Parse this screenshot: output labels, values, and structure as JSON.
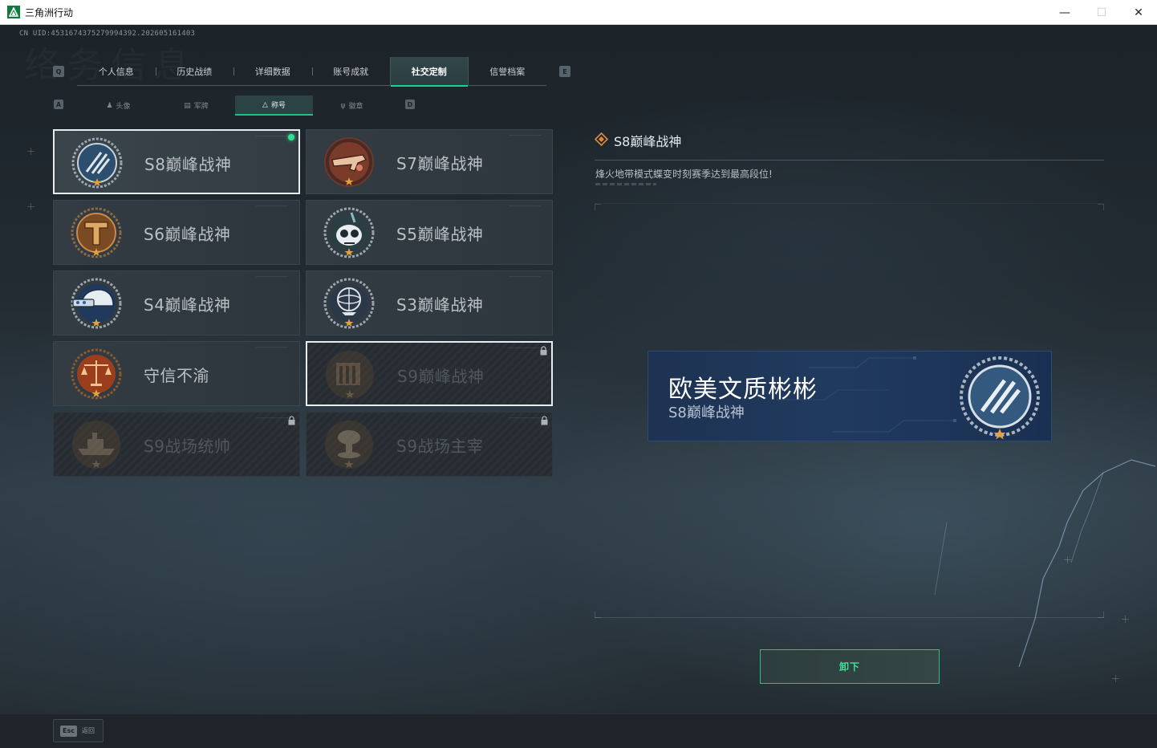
{
  "window": {
    "title": "三角洲行动",
    "controls": [
      "minimize",
      "maximize",
      "close"
    ]
  },
  "uid_text": "CN UID:4531674375279994392.202605161403",
  "watermark_text": "络务信息",
  "main_tabs": {
    "left_key": "Q",
    "right_key": "E",
    "active_index": 4,
    "items": [
      {
        "label": "个人信息"
      },
      {
        "label": "历史战绩"
      },
      {
        "label": "详细数据"
      },
      {
        "label": "账号成就"
      },
      {
        "label": "社交定制"
      },
      {
        "label": "信誉档案"
      }
    ]
  },
  "sub_tabs": {
    "left_key": "A",
    "right_key": "D",
    "active_index": 2,
    "items": [
      {
        "label": "头像",
        "icon": "person-icon"
      },
      {
        "label": "军牌",
        "icon": "dogtag-icon"
      },
      {
        "label": "称号",
        "icon": "title-triangle-icon"
      },
      {
        "label": "徽章",
        "icon": "badge-icon"
      }
    ]
  },
  "titles": [
    {
      "label": "S8巅峰战神",
      "medal": "s8-medal-icon",
      "equipped": true,
      "locked": false,
      "selected": true
    },
    {
      "label": "S7巅峰战神",
      "medal": "s7-medal-icon",
      "equipped": false,
      "locked": false,
      "selected": false
    },
    {
      "label": "S6巅峰战神",
      "medal": "s6-medal-icon",
      "equipped": false,
      "locked": false,
      "selected": false
    },
    {
      "label": "S5巅峰战神",
      "medal": "s5-medal-icon",
      "equipped": false,
      "locked": false,
      "selected": false
    },
    {
      "label": "S4巅峰战神",
      "medal": "s4-medal-icon",
      "equipped": false,
      "locked": false,
      "selected": false
    },
    {
      "label": "S3巅峰战神",
      "medal": "s3-medal-icon",
      "equipped": false,
      "locked": false,
      "selected": false
    },
    {
      "label": "守信不渝",
      "medal": "scales-medal-icon",
      "equipped": false,
      "locked": false,
      "selected": false
    },
    {
      "label": "S9巅峰战神",
      "medal": "s9-medal-icon",
      "equipped": false,
      "locked": true,
      "selected": true
    },
    {
      "label": "S9战场统帅",
      "medal": "ship-medal-icon",
      "equipped": false,
      "locked": true,
      "selected": false
    },
    {
      "label": "S9战场主宰",
      "medal": "mushroom-cloud-medal-icon",
      "equipped": false,
      "locked": true,
      "selected": false
    }
  ],
  "detail": {
    "title": "S8巅峰战神",
    "description": "烽火地带模式蝶变时刻赛季达到最高段位!",
    "preview": {
      "player_name": "欧美文质彬彬",
      "title_text": "S8巅峰战神"
    },
    "action_label": "卸下"
  },
  "footer": {
    "esc_key": "Esc",
    "esc_label": "返回"
  },
  "colors": {
    "accent_green": "#1ed28a",
    "equipped_dot": "#2ee08f",
    "banner_blue": "#203a5e"
  }
}
